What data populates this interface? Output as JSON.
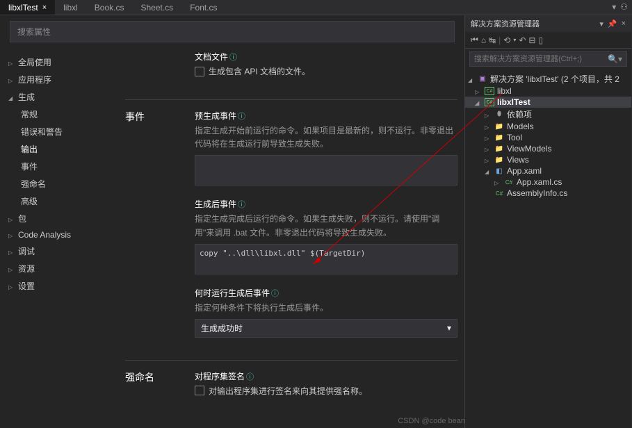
{
  "tabs": [
    {
      "label": "libxlTest",
      "active": true
    },
    {
      "label": "libxl",
      "active": false
    },
    {
      "label": "Book.cs",
      "active": false
    },
    {
      "label": "Sheet.cs",
      "active": false
    },
    {
      "label": "Font.cs",
      "active": false
    }
  ],
  "search_placeholder": "搜索属性",
  "sidebar": [
    {
      "label": "全局使用",
      "level": 1,
      "expand": "closed"
    },
    {
      "label": "应用程序",
      "level": 1,
      "expand": "closed"
    },
    {
      "label": "生成",
      "level": 1,
      "expand": "open"
    },
    {
      "label": "常规",
      "level": 2
    },
    {
      "label": "错误和警告",
      "level": 2
    },
    {
      "label": "输出",
      "level": 2,
      "selected": true
    },
    {
      "label": "事件",
      "level": 2
    },
    {
      "label": "强命名",
      "level": 2
    },
    {
      "label": "高级",
      "level": 2
    },
    {
      "label": "包",
      "level": 1,
      "expand": "closed"
    },
    {
      "label": "Code Analysis",
      "level": 1,
      "expand": "closed"
    },
    {
      "label": "调试",
      "level": 1,
      "expand": "closed"
    },
    {
      "label": "资源",
      "level": 1,
      "expand": "closed"
    },
    {
      "label": "设置",
      "level": 1,
      "expand": "closed"
    }
  ],
  "props": {
    "doc_section_partial": {
      "title": "文档文件",
      "checkbox": "生成包含 API 文档的文件。"
    },
    "events_label": "事件",
    "pre_build": {
      "title": "预生成事件",
      "desc": "指定生成开始前运行的命令。如果项目是最新的，则不运行。非零退出代码将在生成运行前导致生成失败。",
      "value": ""
    },
    "post_build": {
      "title": "生成后事件",
      "desc": "指定生成完成后运行的命令。如果生成失败，则不运行。请使用\"调用\"来调用 .bat 文件。非零退出代码将导致生成失败。",
      "value": "copy \"..\\dll\\libxl.dll\" $(TargetDir)"
    },
    "when_run": {
      "title": "何时运行生成后事件",
      "desc": "指定何种条件下将执行生成后事件。",
      "value": "生成成功时"
    },
    "strong_label": "强命名",
    "signing": {
      "title": "对程序集签名",
      "desc": "对输出程序集进行签名来向其提供强名称。"
    }
  },
  "solution_explorer": {
    "title": "解决方案资源管理器",
    "search_placeholder": "搜索解决方案资源管理器(Ctrl+;)",
    "solution": "解决方案 'libxlTest' (2 个项目，共 2",
    "nodes": [
      {
        "label": "libxl",
        "icon": "cs",
        "ind": 1,
        "expand": "closed"
      },
      {
        "label": "libxlTest",
        "icon": "cs",
        "ind": 1,
        "expand": "open",
        "selected": true
      },
      {
        "label": "依赖项",
        "icon": "ref",
        "ind": 2,
        "expand": "closed"
      },
      {
        "label": "Models",
        "icon": "folder",
        "ind": 2,
        "expand": "closed"
      },
      {
        "label": "Tool",
        "icon": "folder",
        "ind": 2,
        "expand": "closed"
      },
      {
        "label": "ViewModels",
        "icon": "folder",
        "ind": 2,
        "expand": "closed"
      },
      {
        "label": "Views",
        "icon": "folder",
        "ind": 2,
        "expand": "closed"
      },
      {
        "label": "App.xaml",
        "icon": "xaml",
        "ind": 2,
        "expand": "open"
      },
      {
        "label": "App.xaml.cs",
        "icon": "csfile",
        "ind": 3,
        "expand": "closed"
      },
      {
        "label": "AssemblyInfo.cs",
        "icon": "csfile",
        "ind": 2
      }
    ]
  },
  "watermark": "CSDN @code bean"
}
